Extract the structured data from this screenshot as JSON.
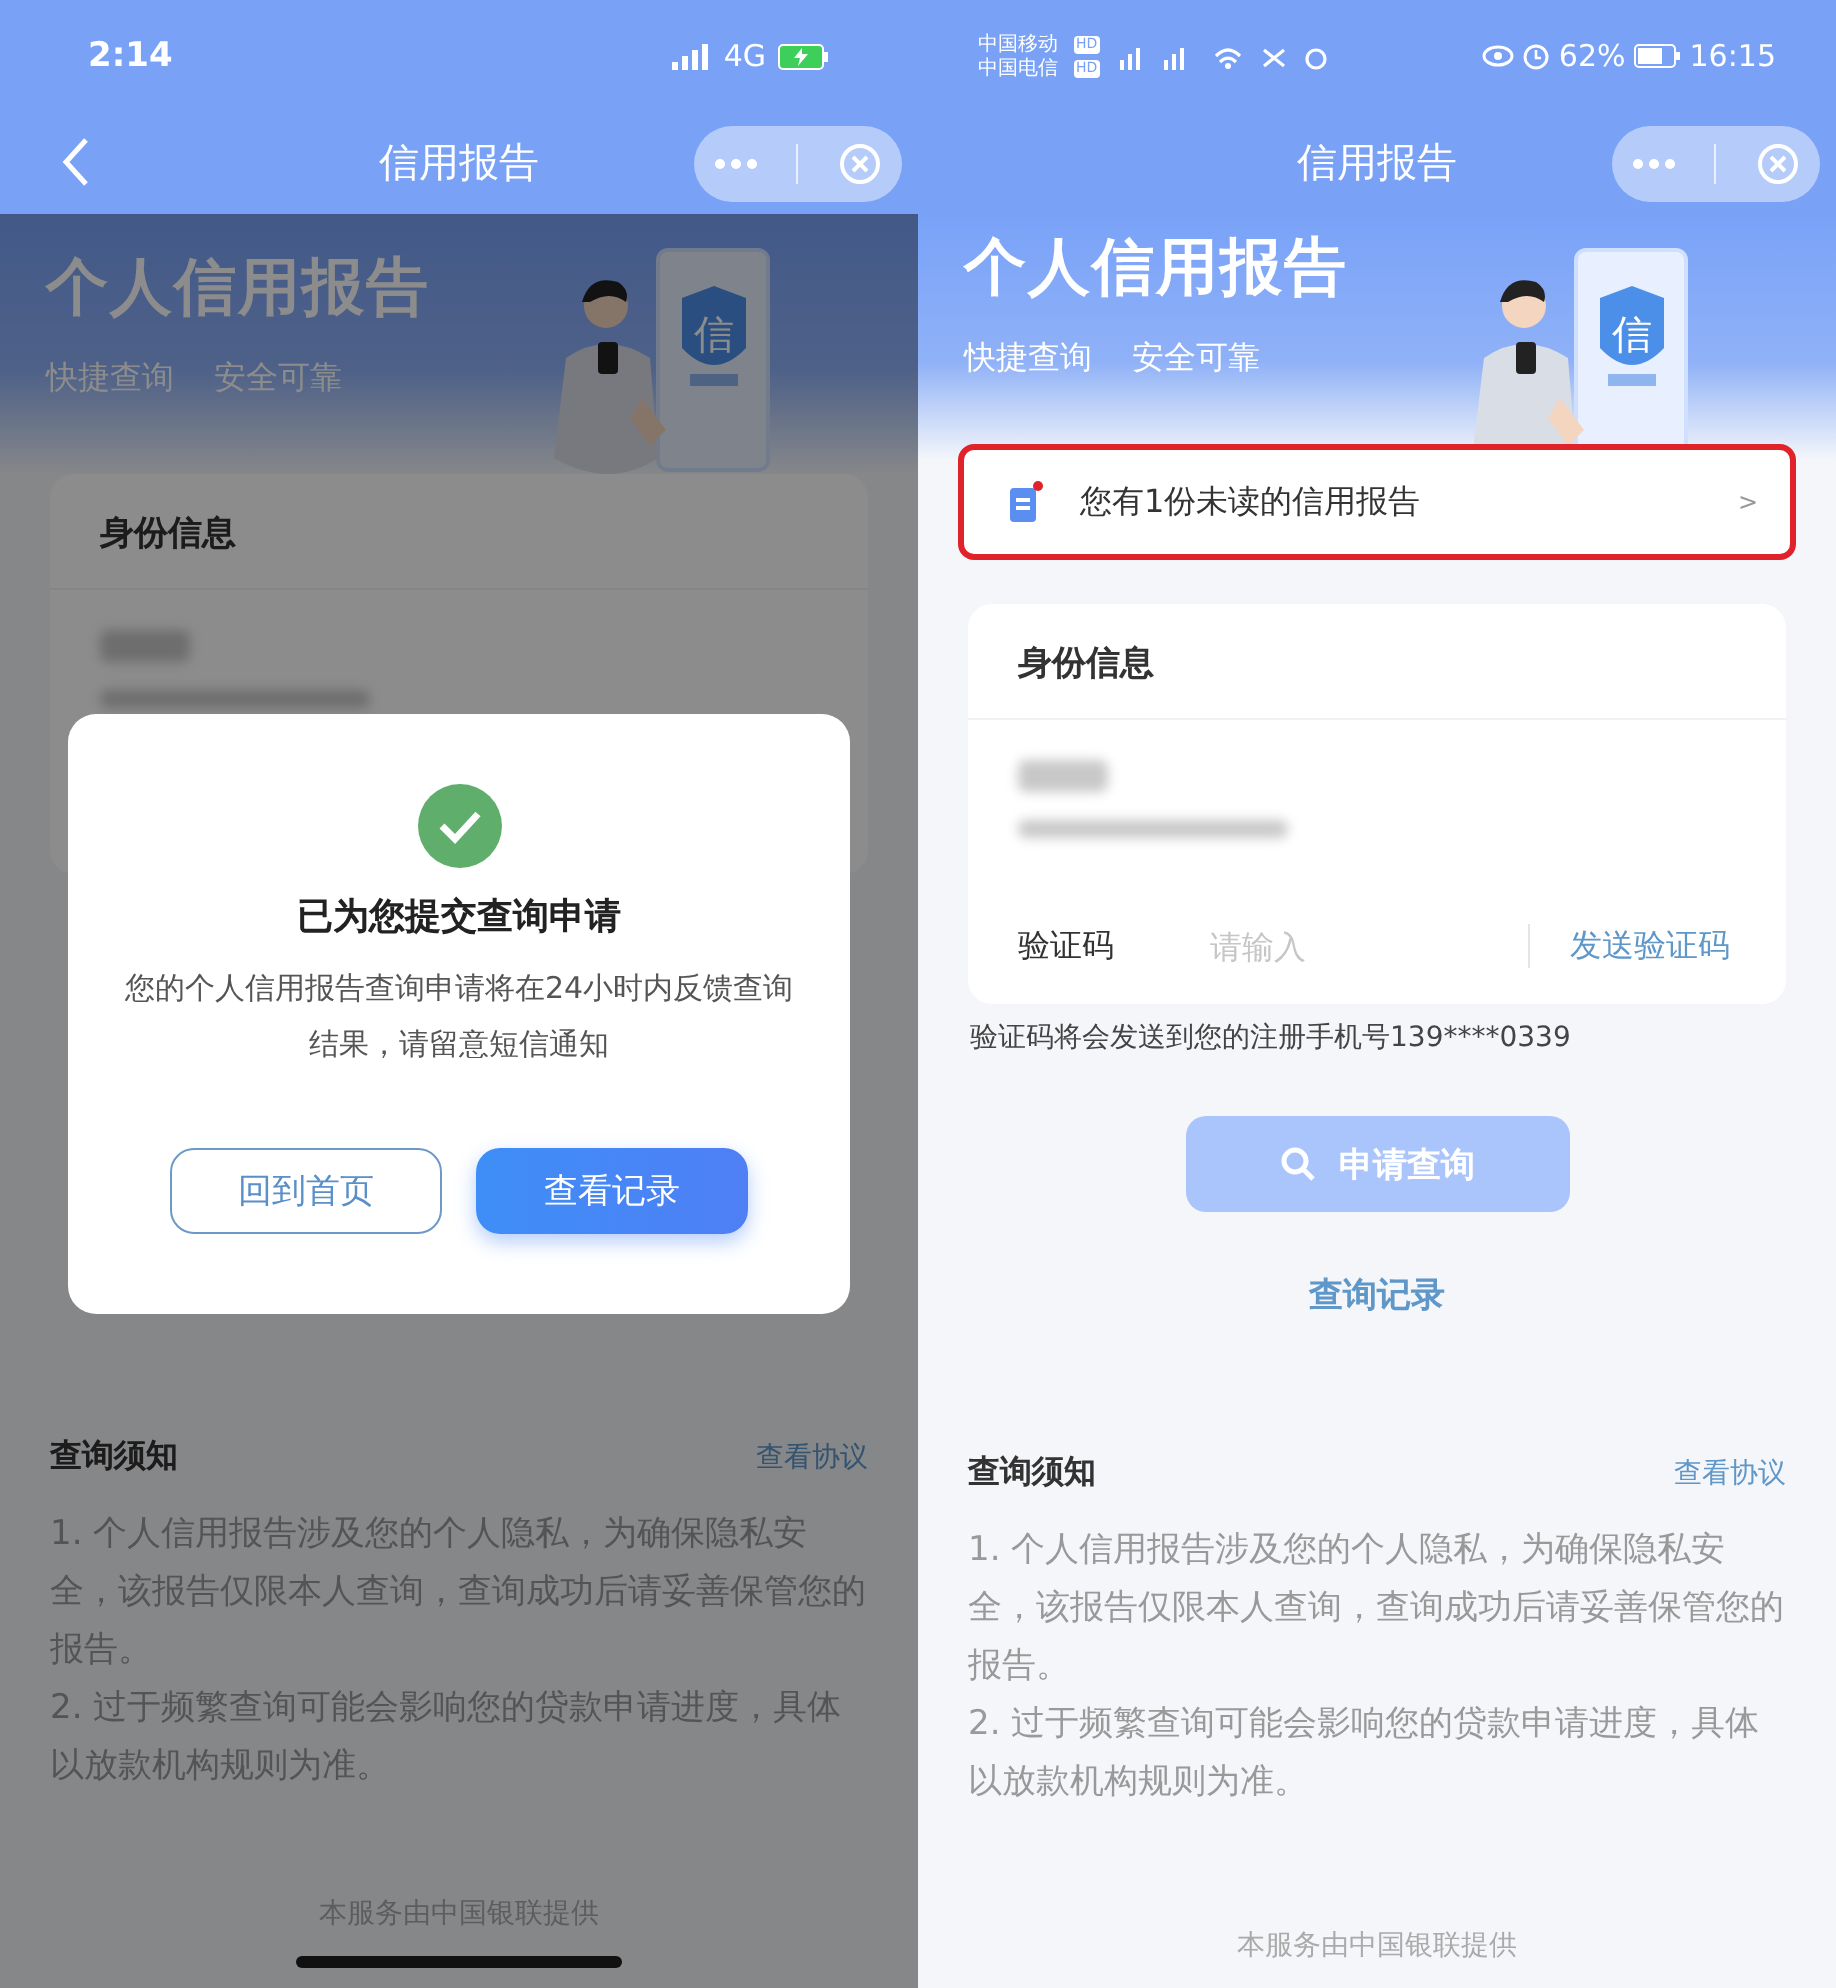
{
  "screens": [
    {
      "status_bar": {
        "kind": "ios",
        "time": "2:14",
        "network": "4G"
      },
      "nav": {
        "kind": "with_back",
        "title": "信用报告"
      },
      "hero": {
        "title": "个人信用报告",
        "subtitle": [
          "快捷查询",
          "安全可靠"
        ],
        "shield_label": "信"
      },
      "identity": {
        "title": "身份信息"
      },
      "notice": {
        "title": "查询须知",
        "link": "查看协议",
        "items": [
          "1. 个人信用报告涉及您的个人隐私，为确保隐私安全，该报告仅限本人查询，查询成功后请妥善保管您的报告。",
          "2. 过于频繁查询可能会影响您的贷款申请进度，具体以放款机构规则为准。"
        ]
      },
      "footer": "本服务由中国银联提供",
      "dialog": {
        "title": "已为您提交查询申请",
        "message": "您的个人信用报告查询申请将在24小时内反馈查询结果，请留意短信通知",
        "buttons": [
          {
            "label": "回到首页",
            "kind": "outline"
          },
          {
            "label": "查看记录",
            "kind": "primary"
          }
        ]
      }
    },
    {
      "status_bar": {
        "kind": "android",
        "carriers": [
          {
            "name": "中国移动",
            "badge": "HD"
          },
          {
            "name": "中国电信",
            "badge": "HD"
          }
        ],
        "battery": "62%",
        "time": "16:15"
      },
      "nav": {
        "kind": "plain",
        "title": "信用报告"
      },
      "hero": {
        "title": "个人信用报告",
        "subtitle": [
          "快捷查询",
          "安全可靠"
        ],
        "shield_label": "信"
      },
      "banner": {
        "text": "您有1份未读的信用报告",
        "chevron": ">",
        "highlighted": true
      },
      "identity": {
        "title": "身份信息",
        "code_label": "验证码",
        "code_placeholder": "请输入",
        "send_link": "发送验证码"
      },
      "hint": "验证码将会发送到您的注册手机号139****0339",
      "search_button": {
        "label": "申请查询",
        "disabled": true
      },
      "records_link": "查询记录",
      "notice": {
        "title": "查询须知",
        "link": "查看协议",
        "items": [
          "1. 个人信用报告涉及您的个人隐私，为确保隐私安全，该报告仅限本人查询，查询成功后请妥善保管您的报告。",
          "2. 过于频繁查询可能会影响您的贷款申请进度，具体以放款机构规则为准。"
        ]
      },
      "footer": "本服务由中国银联提供"
    }
  ]
}
